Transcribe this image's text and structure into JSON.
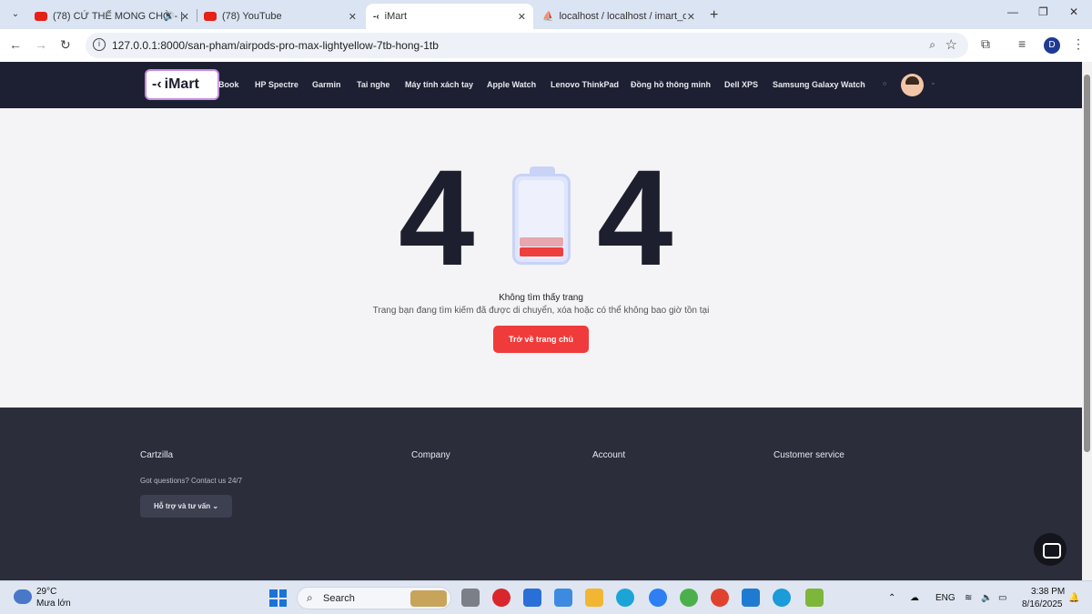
{
  "browser": {
    "tabs": [
      {
        "title": "(78) CỨ THẾ MONG CHỜ - |"
      },
      {
        "title": "(78) YouTube"
      },
      {
        "title": "iMart"
      },
      {
        "title": "localhost / localhost / imart_dat"
      }
    ],
    "url": "127.0.0.1:8000/san-pham/airpods-pro-max-lightyellow-7tb-hong-1tb",
    "profile_initial": "D"
  },
  "site": {
    "logo_text": "iMart",
    "nav": [
      "Book",
      "HP Spectre",
      "Garmin",
      "Tai nghe",
      "Máy tính xách tay",
      "Apple Watch",
      "Lenovo ThinkPad",
      "Đồng hồ thông minh",
      "Dell XPS",
      "Samsung Galaxy Watch"
    ]
  },
  "error": {
    "digit_left": "4",
    "digit_right": "4",
    "title": "Không tìm thấy trang",
    "description": "Trang bạn đang tìm kiếm đã được di chuyển, xóa hoặc có thể không bao giờ tồn tại",
    "home_button": "Trở về trang chủ"
  },
  "footer": {
    "columns": [
      "Cartzilla",
      "Company",
      "Account",
      "Customer service"
    ],
    "contact_text": "Got questions? Contact us 24/7",
    "support_button": "Hỗ trợ và tư vấn ⌄"
  },
  "taskbar": {
    "temperature": "29°C",
    "weather": "Mưa lớn",
    "search_label": "Search",
    "language": "ENG",
    "time": "3:38 PM",
    "date": "8/16/2025"
  },
  "colors": {
    "header_bg": "#1d2032",
    "primary_button": "#ef3b3b",
    "footer_bg": "#2b2d3b"
  }
}
